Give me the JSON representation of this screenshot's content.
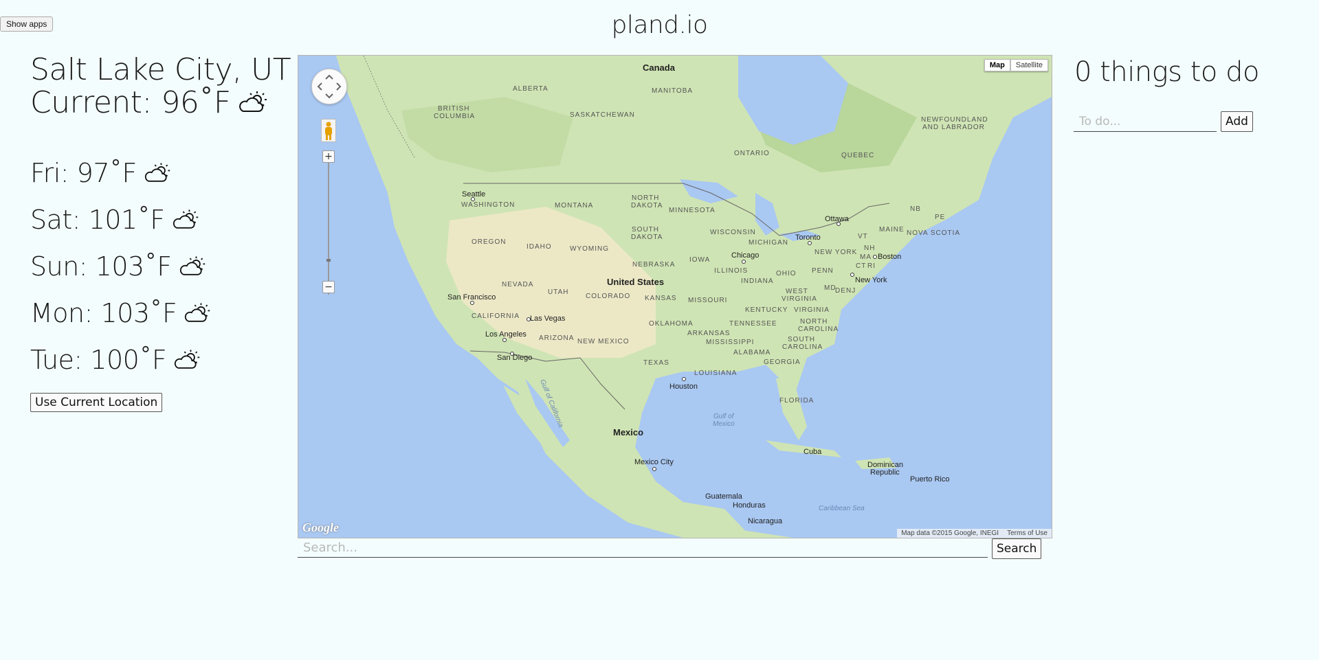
{
  "header": {
    "show_apps_label": "Show apps",
    "site_title": "pland.io"
  },
  "weather": {
    "city": "Salt Lake City, UT",
    "current_label": "Current: 96˚F",
    "forecast": [
      {
        "day_temp": "Fri: 97˚F",
        "icon": "partly-cloudy-icon"
      },
      {
        "day_temp": "Sat: 101˚F",
        "icon": "partly-cloudy-icon"
      },
      {
        "day_temp": "Sun: 103˚F",
        "icon": "partly-cloudy-icon"
      },
      {
        "day_temp": "Mon: 103˚F",
        "icon": "partly-cloudy-icon"
      },
      {
        "day_temp": "Tue: 100˚F",
        "icon": "partly-cloudy-icon"
      }
    ],
    "use_location_label": "Use Current Location"
  },
  "map": {
    "map_type": {
      "map_label": "Map",
      "satellite_label": "Satellite",
      "selected": "Map"
    },
    "logo": "Google",
    "attribution": "Map data ©2015 Google, INEGI",
    "terms": "Terms of Use",
    "labels": {
      "canada": "Canada",
      "united_states": "United States",
      "mexico": "Mexico",
      "alberta": "ALBERTA",
      "manitoba": "MANITOBA",
      "british_columbia_1": "BRITISH",
      "british_columbia_2": "COLUMBIA",
      "saskatchewan": "SASKATCHEWAN",
      "ontario": "ONTARIO",
      "quebec": "QUEBEC",
      "newfoundland_1": "NEWFOUNDLAND",
      "newfoundland_2": "AND LABRADOR",
      "washington": "WASHINGTON",
      "montana": "MONTANA",
      "north_dakota_1": "NORTH",
      "north_dakota_2": "DAKOTA",
      "minnesota": "MINNESOTA",
      "south_dakota_1": "SOUTH",
      "south_dakota_2": "DAKOTA",
      "wisconsin": "WISCONSIN",
      "michigan": "MICHIGAN",
      "oregon": "OREGON",
      "idaho": "IDAHO",
      "wyoming": "WYOMING",
      "nebraska": "NEBRASKA",
      "iowa": "IOWA",
      "illinois": "ILLINOIS",
      "indiana": "INDIANA",
      "ohio": "OHIO",
      "penn": "PENN",
      "new_york": "NEW YORK",
      "nevada": "NEVADA",
      "utah": "UTAH",
      "colorado": "COLORADO",
      "kansas": "KANSAS",
      "missouri": "MISSOURI",
      "kentucky": "KENTUCKY",
      "west_virginia_1": "WEST",
      "west_virginia_2": "VIRGINIA",
      "virginia": "VIRGINIA",
      "california": "CALIFORNIA",
      "arizona": "ARIZONA",
      "new_mexico": "NEW MEXICO",
      "oklahoma": "OKLAHOMA",
      "arkansas": "ARKANSAS",
      "tennessee": "TENNESSEE",
      "north_carolina_1": "NORTH",
      "north_carolina_2": "CAROLINA",
      "south_carolina_1": "SOUTH",
      "south_carolina_2": "CAROLINA",
      "mississippi": "MISSISSIPPI",
      "alabama": "ALABAMA",
      "georgia": "GEORGIA",
      "texas": "TEXAS",
      "louisiana": "LOUISIANA",
      "florida": "FLORIDA",
      "maine": "MAINE",
      "nova_scotia": "NOVA SCOTIA",
      "nb": "NB",
      "pe": "PE",
      "vt": "VT",
      "nh": "NH",
      "ma": "MA",
      "ct": "CT",
      "ri": "RI",
      "md": "MD",
      "de": "DE",
      "nj": "NJ",
      "seattle": "Seattle",
      "ottawa": "Ottawa",
      "toronto": "Toronto",
      "chicago": "Chicago",
      "boston": "Boston",
      "new_york_city": "New York",
      "san_francisco": "San Francisco",
      "las_vegas": "Las Vegas",
      "los_angeles": "Los Angeles",
      "san_diego": "San Diego",
      "houston": "Houston",
      "mexico_city": "Mexico City",
      "cuba": "Cuba",
      "dominican_1": "Dominican",
      "dominican_2": "Republic",
      "puerto_rico": "Puerto Rico",
      "guatemala": "Guatemala",
      "honduras": "Honduras",
      "nicaragua": "Nicaragua",
      "gulf_of_mexico_1": "Gulf of",
      "gulf_of_mexico_2": "Mexico",
      "gulf_of_california": "Gulf of California",
      "caribbean_sea": "Caribbean Sea"
    }
  },
  "search": {
    "placeholder": "Search...",
    "button_label": "Search"
  },
  "todo": {
    "title": "0 things to do",
    "placeholder": "To do...",
    "add_label": "Add"
  }
}
